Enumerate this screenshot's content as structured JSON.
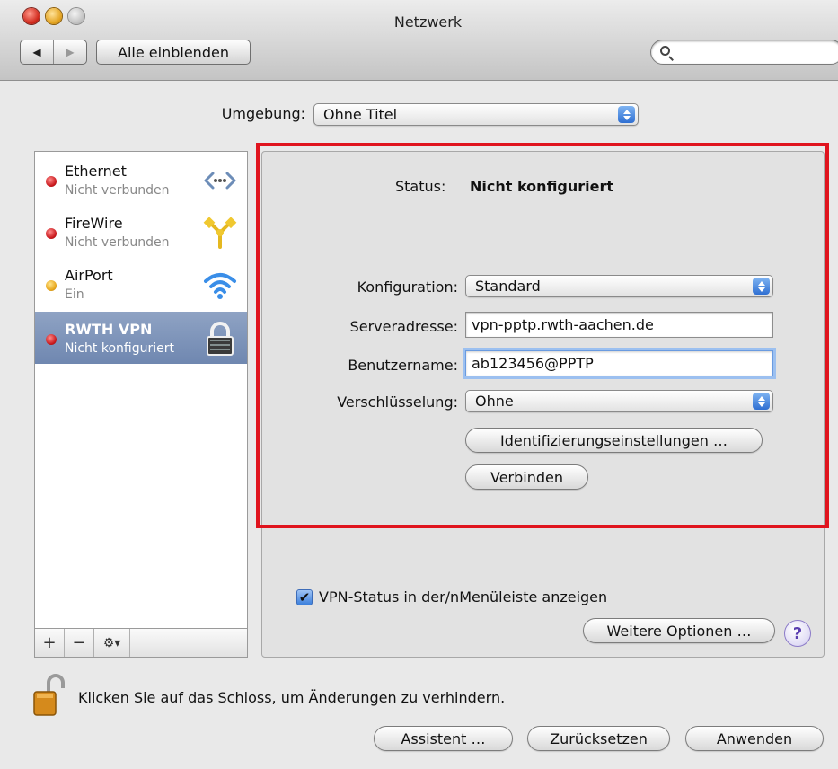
{
  "window": {
    "title": "Netzwerk"
  },
  "toolbar": {
    "back_label": "◀",
    "forward_label": "▶",
    "show_all_label": "Alle einblenden",
    "search_placeholder": ""
  },
  "location": {
    "label": "Umgebung:",
    "value": "Ohne Titel"
  },
  "services": [
    {
      "name": "Ethernet",
      "status": "Nicht verbunden",
      "status_color": "#c8171b",
      "icon": "ethernet-icon"
    },
    {
      "name": "FireWire",
      "status": "Nicht verbunden",
      "status_color": "#c8171b",
      "icon": "firewire-icon"
    },
    {
      "name": "AirPort",
      "status": "Ein",
      "status_color": "#e7a51a",
      "icon": "airport-wifi-icon"
    },
    {
      "name": "RWTH VPN",
      "status": "Nicht konfiguriert",
      "status_color": "#c8171b",
      "icon": "vpn-lock-icon",
      "selected": true
    }
  ],
  "sidebar_toolbar": {
    "add_label": "+",
    "remove_label": "−",
    "gear_label": "⚙▾"
  },
  "detail": {
    "status_label": "Status:",
    "status_value": "Nicht konfiguriert",
    "configuration_label": "Konfiguration:",
    "configuration_value": "Standard",
    "server_label": "Serveradresse:",
    "server_value": "vpn-pptp.rwth-aachen.de",
    "account_label": "Benutzername:",
    "account_value": "ab123456@PPTP",
    "encryption_label": "Verschlüsselung:",
    "encryption_value": "Ohne",
    "auth_settings_label": "Identifizierungseinstellungen …",
    "connect_label": "Verbinden",
    "show_status_label": "VPN-Status in der/nMenüleiste anzeigen",
    "show_status_checked": "✔",
    "advanced_label": "Weitere Optionen …",
    "help_label": "?"
  },
  "footer": {
    "lock_text": "Klicken Sie auf das Schloss, um Änderungen zu verhindern.",
    "assist_label": "Assistent …",
    "revert_label": "Zurücksetzen",
    "apply_label": "Anwenden"
  },
  "colors": {
    "highlight_box": "#e0141e",
    "selection": "#7a8fb5",
    "accent": "#3b7fdc"
  }
}
